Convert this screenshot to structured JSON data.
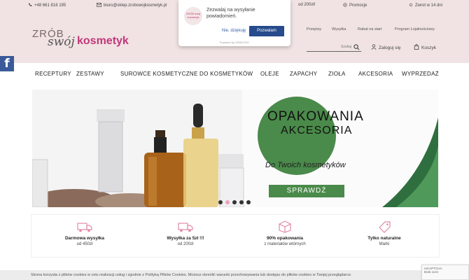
{
  "topbar": {
    "phone": "+48 661 816 195",
    "email": "biuro@sklep.zrobswojkosmetyk.pl",
    "free_shipping_partial": "od 200zł!",
    "promotions": "Promocje",
    "returns": "Zwrot w 14 dni"
  },
  "header": {
    "logo_line1": "ZRÓB",
    "logo_line2": "swój",
    "logo_line3": "kosmetyk",
    "links": [
      "Przepisy",
      "Wysyłka",
      "Rabat na start",
      "Program Lojalnościowy"
    ],
    "search_placeholder": "Szukaj",
    "account_label": "Zaloguj się",
    "cart_label": "Koszyk"
  },
  "social": {
    "facebook_label": "f"
  },
  "nav": {
    "items": [
      "RECEPTURY",
      "ZESTAWY",
      "SUROWCE KOSMETYCZNE",
      "DO KOSMETYKÓW",
      "OLEJE",
      "ZAPACHY",
      "ZIOŁA",
      "AKCESORIA",
      "WYPRZEDAŻ"
    ]
  },
  "banner": {
    "title_line1": "OPAKOWANIA",
    "title_line2": "AKCESORIA",
    "subtitle": "Do Twoich kosmetyków",
    "cta": "SPRAWDŹ",
    "slide_count": 5,
    "active_slide": 2
  },
  "features": [
    {
      "icon": "free-shipping-icon",
      "title": "Darmowa wysyłka",
      "subtitle": "od 450zł"
    },
    {
      "icon": "delivery-truck-icon",
      "title": "Wysyłka za 5zł !!!",
      "subtitle": "od 200zł"
    },
    {
      "icon": "package-icon",
      "title": "90% opakowania",
      "subtitle": "z materiałów wtórnych"
    },
    {
      "icon": "leaf-tag-icon",
      "title": "Tylko naturalne",
      "subtitle": "Marki"
    }
  ],
  "cookie": {
    "text": "Strona korzysta z plików cookies w celu realizacji usług i zgodnie z Polityką Plików Cookies. Możesz określić warunki przechowywania lub dostępu do plików cookies w Twojej przeglądarce."
  },
  "recaptcha": {
    "line1": "reCAPTCHA",
    "line2": "Brak ocen"
  },
  "popup": {
    "logo_text": "ZRÓB swój kosmetyk",
    "message": "Zezwalaj na wysyłanie powiadomień.",
    "decline": "Nie, dziękuję",
    "accept": "Pozwalam",
    "powered": "Powered by GRAVITEC"
  },
  "colors": {
    "header_bg": "#f1e3e3",
    "brand_pink": "#c1377a",
    "banner_green": "#4a8a4a",
    "popup_button": "#274b8c",
    "facebook": "#3b5a9a"
  }
}
